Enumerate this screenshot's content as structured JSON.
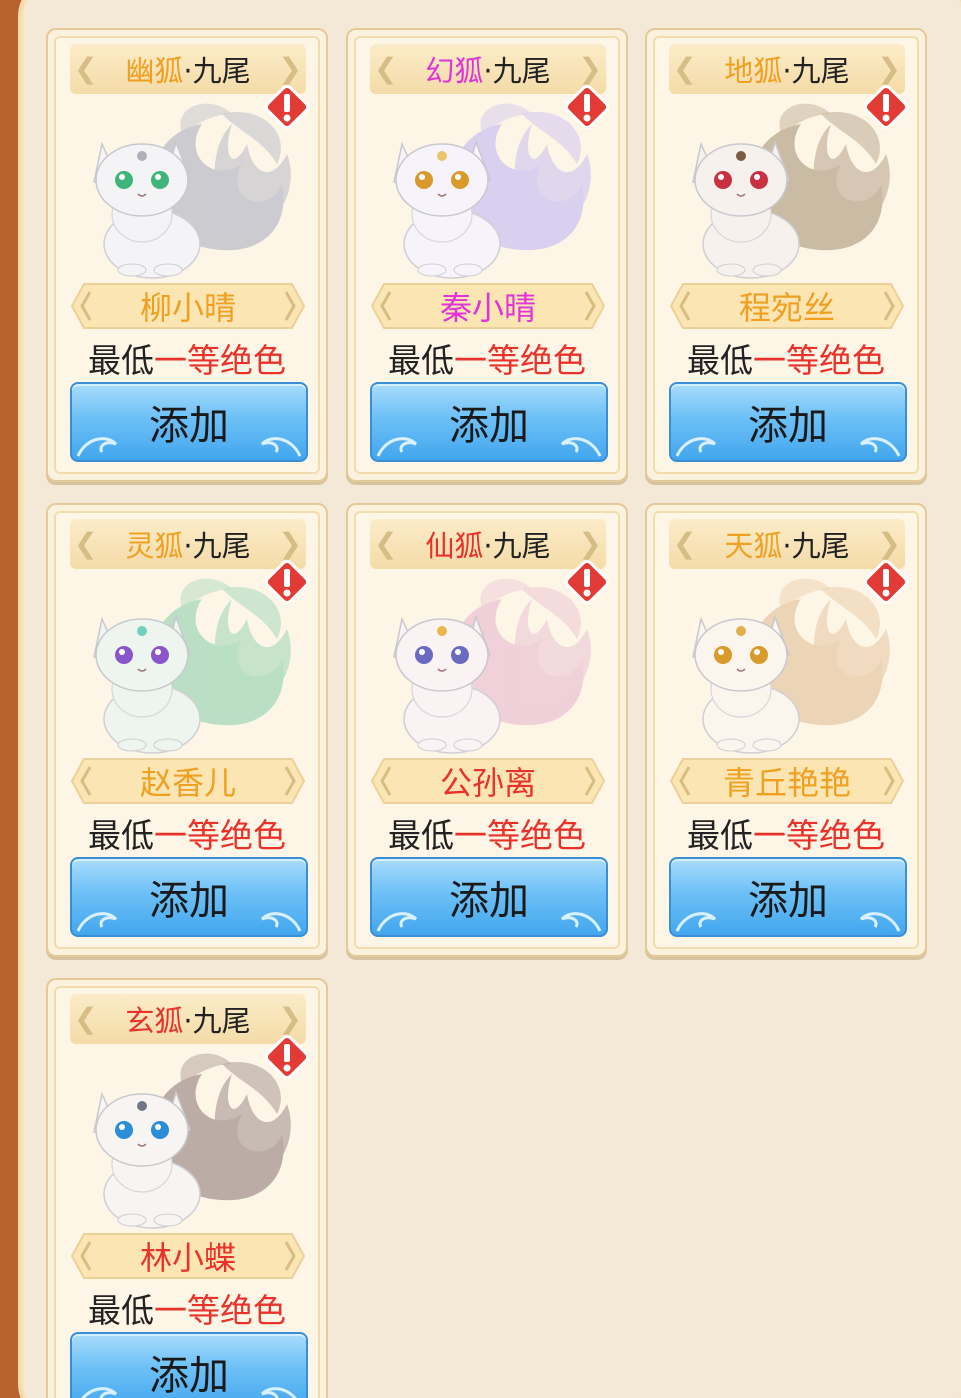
{
  "colors": {
    "name_gold": "#f0a020",
    "name_magenta": "#e034d8",
    "name_red": "#e8322a",
    "grade_highlight": "#e8322a"
  },
  "cards": [
    {
      "prefix": "幽狐",
      "suffix": "·九尾",
      "prefix_color": "#f0a020",
      "name": "柳小晴",
      "name_color": "#f0a020",
      "grade_prefix": "最低",
      "grade_value": "一等绝色",
      "button": "添加",
      "fox": {
        "body": "#f4f4f6",
        "tail": "#c9c9cf",
        "eye": "#3fb57a",
        "accent": "#b0b0b8"
      }
    },
    {
      "prefix": "幻狐",
      "suffix": "·九尾",
      "prefix_color": "#e034d8",
      "name": "秦小晴",
      "name_color": "#e034d8",
      "grade_prefix": "最低",
      "grade_value": "一等绝色",
      "button": "添加",
      "fox": {
        "body": "#f7f3fb",
        "tail": "#d8cdef",
        "eye": "#d89a2a",
        "accent": "#e9c46a"
      }
    },
    {
      "prefix": "地狐",
      "suffix": "·九尾",
      "prefix_color": "#f0a020",
      "name": "程宛丝",
      "name_color": "#f0a020",
      "grade_prefix": "最低",
      "grade_value": "一等绝色",
      "button": "添加",
      "fox": {
        "body": "#f6f1ec",
        "tail": "#c8b8a2",
        "eye": "#c93040",
        "accent": "#7a5a40"
      }
    },
    {
      "prefix": "灵狐",
      "suffix": "·九尾",
      "prefix_color": "#f0a020",
      "name": "赵香儿",
      "name_color": "#f0a020",
      "grade_prefix": "最低",
      "grade_value": "一等绝色",
      "button": "添加",
      "fox": {
        "body": "#eef5ef",
        "tail": "#b7dec3",
        "eye": "#8a55c8",
        "accent": "#6fd0c0"
      }
    },
    {
      "prefix": "仙狐",
      "suffix": "·九尾",
      "prefix_color": "#e8322a",
      "name": "公孙离",
      "name_color": "#e8322a",
      "grade_prefix": "最低",
      "grade_value": "一等绝色",
      "button": "添加",
      "fox": {
        "body": "#fbf2f4",
        "tail": "#efcfd8",
        "eye": "#6a6ac0",
        "accent": "#e8b84a"
      }
    },
    {
      "prefix": "天狐",
      "suffix": "·九尾",
      "prefix_color": "#f0a020",
      "name": "青丘艳艳",
      "name_color": "#f0a020",
      "grade_prefix": "最低",
      "grade_value": "一等绝色",
      "button": "添加",
      "fox": {
        "body": "#fbf5ee",
        "tail": "#ecd3b4",
        "eye": "#d89a2a",
        "accent": "#e0b050"
      }
    },
    {
      "prefix": "玄狐",
      "suffix": "·九尾",
      "prefix_color": "#e8322a",
      "name": "林小蝶",
      "name_color": "#e8322a",
      "grade_prefix": "最低",
      "grade_value": "一等绝色",
      "button": "添加",
      "fox": {
        "body": "#f7f4f2",
        "tail": "#b8a9a2",
        "eye": "#2a8fd8",
        "accent": "#707888"
      }
    }
  ]
}
